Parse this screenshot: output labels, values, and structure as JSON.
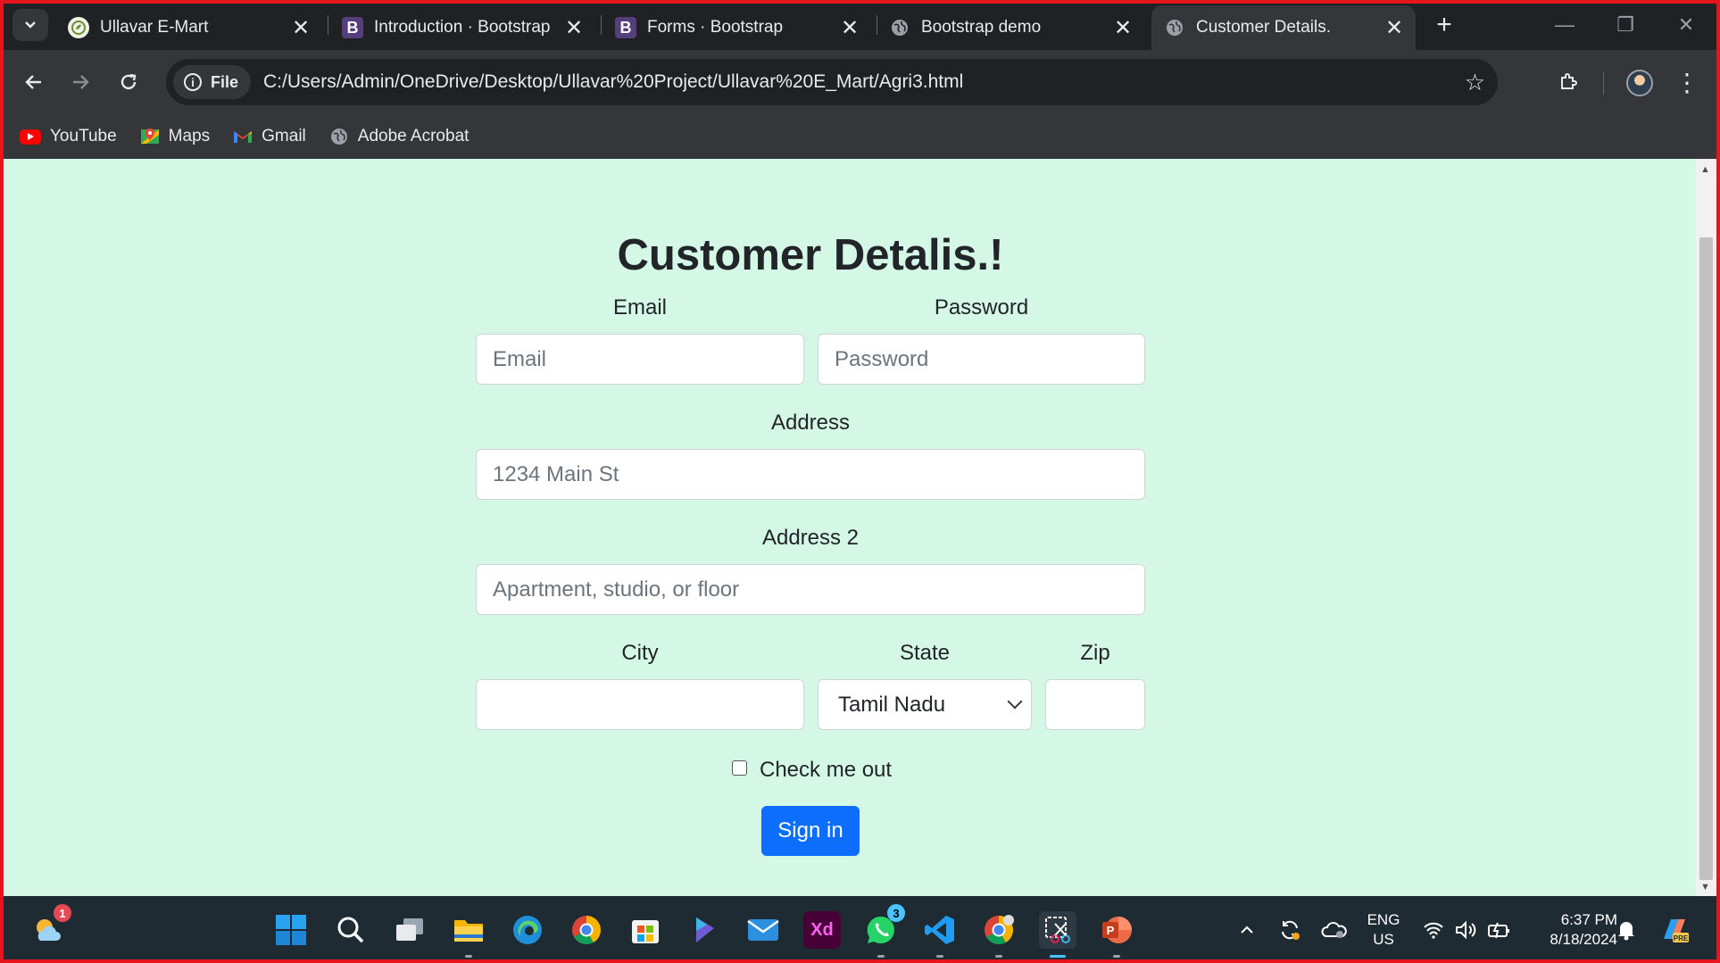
{
  "browser": {
    "tabs": [
      {
        "title": "Ullavar E-Mart",
        "icon": "leaf-logo-icon"
      },
      {
        "title": "Introduction · Bootstrap",
        "icon": "bootstrap-icon"
      },
      {
        "title": "Forms · Bootstrap",
        "icon": "bootstrap-icon"
      },
      {
        "title": "Bootstrap demo",
        "icon": "globe-icon"
      },
      {
        "title": "Customer Details.",
        "icon": "globe-icon",
        "active": true
      }
    ],
    "address": {
      "scheme_label": "File",
      "url": "C:/Users/Admin/OneDrive/Desktop/Ullavar%20Project/Ullavar%20E_Mart/Agri3.html"
    },
    "bookmarks": [
      {
        "label": "YouTube",
        "icon": "youtube-icon",
        "color": "#ff0000"
      },
      {
        "label": "Maps",
        "icon": "maps-icon",
        "color": "#34a853"
      },
      {
        "label": "Gmail",
        "icon": "gmail-icon",
        "color": "#ea4335"
      },
      {
        "label": "Adobe Acrobat",
        "icon": "globe-icon",
        "color": "#9aa0a6"
      }
    ]
  },
  "page": {
    "background": "#d5f8e6",
    "heading": "Customer Detalis.!",
    "form": {
      "email_label": "Email",
      "email_placeholder": "Email",
      "password_label": "Password",
      "password_placeholder": "Password",
      "address_label": "Address",
      "address_placeholder": "1234 Main St",
      "address2_label": "Address 2",
      "address2_placeholder": "Apartment, studio, or floor",
      "city_label": "City",
      "city_value": "",
      "state_label": "State",
      "state_selected": "Tamil Nadu",
      "zip_label": "Zip",
      "zip_value": "",
      "checkbox_label": "Check me out",
      "checkbox_checked": false,
      "submit_label": "Sign in",
      "button_color": "#0d6efd"
    }
  },
  "taskbar": {
    "weather_badge": "1",
    "whatsapp_badge": "3",
    "language": "ENG",
    "region": "US",
    "time": "6:37 PM",
    "date": "8/18/2024"
  }
}
